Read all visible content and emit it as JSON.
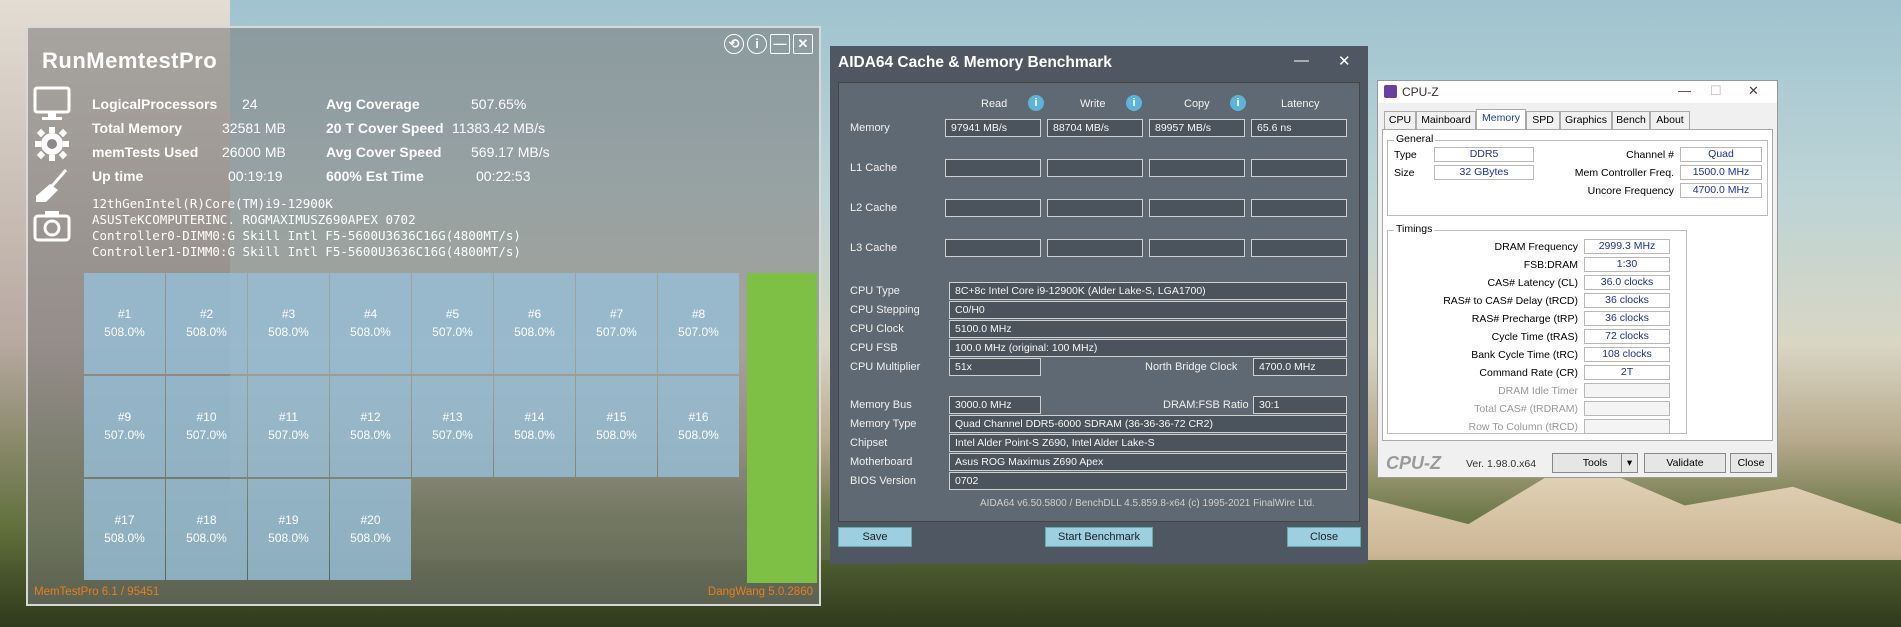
{
  "memtestpro": {
    "title": "RunMemtestPro",
    "window_buttons": [
      "⟲",
      "i",
      "—",
      "✕"
    ],
    "stats_left": [
      {
        "label": "LogicalProcessors",
        "value": "24"
      },
      {
        "label": "Total Memory",
        "value": "32581 MB"
      },
      {
        "label": "memTests Used",
        "value": "26000 MB"
      },
      {
        "label": "Up time",
        "value": "00:19:19"
      }
    ],
    "stats_right": [
      {
        "label": "Avg Coverage",
        "value": "507.65%"
      },
      {
        "label": "20 T Cover Speed",
        "value": "11383.42 MB/s"
      },
      {
        "label": "Avg Cover Speed",
        "value": "569.17 MB/s"
      },
      {
        "label": "600% Est Time",
        "value": "00:22:53"
      }
    ],
    "info_lines": [
      "12thGenIntel(R)Core(TM)i9-12900K",
      "ASUSTeKCOMPUTERINC. ROGMAXIMUSZ690APEX 0702",
      "Controller0-DIMM0:G Skill Intl F5-5600U3636C16G(4800MT/s)",
      "Controller1-DIMM0:G Skill Intl F5-5600U3636C16G(4800MT/s)"
    ],
    "threads": [
      {
        "id": "#1",
        "pct": "508.0%"
      },
      {
        "id": "#2",
        "pct": "508.0%"
      },
      {
        "id": "#3",
        "pct": "508.0%"
      },
      {
        "id": "#4",
        "pct": "508.0%"
      },
      {
        "id": "#5",
        "pct": "507.0%"
      },
      {
        "id": "#6",
        "pct": "508.0%"
      },
      {
        "id": "#7",
        "pct": "507.0%"
      },
      {
        "id": "#8",
        "pct": "507.0%"
      },
      {
        "id": "#9",
        "pct": "507.0%"
      },
      {
        "id": "#10",
        "pct": "507.0%"
      },
      {
        "id": "#11",
        "pct": "507.0%"
      },
      {
        "id": "#12",
        "pct": "508.0%"
      },
      {
        "id": "#13",
        "pct": "507.0%"
      },
      {
        "id": "#14",
        "pct": "508.0%"
      },
      {
        "id": "#15",
        "pct": "508.0%"
      },
      {
        "id": "#16",
        "pct": "508.0%"
      },
      {
        "id": "#17",
        "pct": "508.0%"
      },
      {
        "id": "#18",
        "pct": "508.0%"
      },
      {
        "id": "#19",
        "pct": "508.0%"
      },
      {
        "id": "#20",
        "pct": "508.0%"
      }
    ],
    "footer_left": "MemTestPro 6.1 / 95451",
    "footer_right": "DangWang 5.0.2860",
    "accent_color": "#e87f1c",
    "progress_color": "#7ec046"
  },
  "aida": {
    "title": "AIDA64 Cache & Memory Benchmark",
    "columns": [
      "Read",
      "Write",
      "Copy",
      "Latency"
    ],
    "rows": [
      {
        "label": "Memory",
        "values": [
          "97941 MB/s",
          "88704 MB/s",
          "89957 MB/s",
          "65.6 ns"
        ]
      },
      {
        "label": "L1 Cache",
        "values": [
          "",
          "",
          "",
          ""
        ]
      },
      {
        "label": "L2 Cache",
        "values": [
          "",
          "",
          "",
          ""
        ]
      },
      {
        "label": "L3 Cache",
        "values": [
          "",
          "",
          "",
          ""
        ]
      }
    ],
    "cpu": {
      "type_label": "CPU Type",
      "type": "8C+8c Intel Core i9-12900K  (Alder Lake-S, LGA1700)",
      "stepping_label": "CPU Stepping",
      "stepping": "C0/H0",
      "clock_label": "CPU Clock",
      "clock": "5100.0 MHz",
      "fsb_label": "CPU FSB",
      "fsb": "100.0 MHz  (original: 100 MHz)",
      "mult_label": "CPU Multiplier",
      "mult": "51x",
      "nb_label": "North Bridge Clock",
      "nb": "4700.0 MHz"
    },
    "mem": {
      "bus_label": "Memory Bus",
      "bus": "3000.0 MHz",
      "ratio_label": "DRAM:FSB Ratio",
      "ratio": "30:1",
      "type_label": "Memory Type",
      "type": "Quad Channel DDR5-6000 SDRAM  (36-36-36-72 CR2)",
      "chipset_label": "Chipset",
      "chipset": "Intel Alder Point-S Z690, Intel Alder Lake-S",
      "mb_label": "Motherboard",
      "mb": "Asus ROG Maximus Z690 Apex",
      "bios_label": "BIOS Version",
      "bios": "0702"
    },
    "footer": "AIDA64 v6.50.5800 / BenchDLL 4.5.859.8-x64  (c) 1995-2021 FinalWire Ltd.",
    "save": "Save",
    "start": "Start Benchmark",
    "close": "Close"
  },
  "cpuz": {
    "title": "CPU-Z",
    "tabs": [
      "CPU",
      "Mainboard",
      "Memory",
      "SPD",
      "Graphics",
      "Bench",
      "About"
    ],
    "general_title": "General",
    "type_label": "Type",
    "type": "DDR5",
    "size_label": "Size",
    "size": "32 GBytes",
    "channel_label": "Channel #",
    "channel": "Quad",
    "mcf_label": "Mem Controller Freq.",
    "mcf": "1500.0 MHz",
    "uncore_label": "Uncore Frequency",
    "uncore": "4700.0 MHz",
    "timings_title": "Timings",
    "timings": [
      {
        "label": "DRAM Frequency",
        "value": "2999.3 MHz"
      },
      {
        "label": "FSB:DRAM",
        "value": "1:30"
      },
      {
        "label": "CAS# Latency (CL)",
        "value": "36.0 clocks"
      },
      {
        "label": "RAS# to CAS# Delay (tRCD)",
        "value": "36 clocks"
      },
      {
        "label": "RAS# Precharge (tRP)",
        "value": "36 clocks"
      },
      {
        "label": "Cycle Time (tRAS)",
        "value": "72 clocks"
      },
      {
        "label": "Bank Cycle Time (tRC)",
        "value": "108 clocks"
      },
      {
        "label": "Command Rate (CR)",
        "value": "2T"
      },
      {
        "label": "DRAM Idle Timer",
        "value": ""
      },
      {
        "label": "Total CAS# (tRDRAM)",
        "value": ""
      },
      {
        "label": "Row To Column (tRCD)",
        "value": ""
      }
    ],
    "brand": "CPU-Z",
    "version": "Ver. 1.98.0.x64",
    "tools": "Tools",
    "validate": "Validate",
    "close": "Close",
    "value_color": "#1a2fa0"
  }
}
